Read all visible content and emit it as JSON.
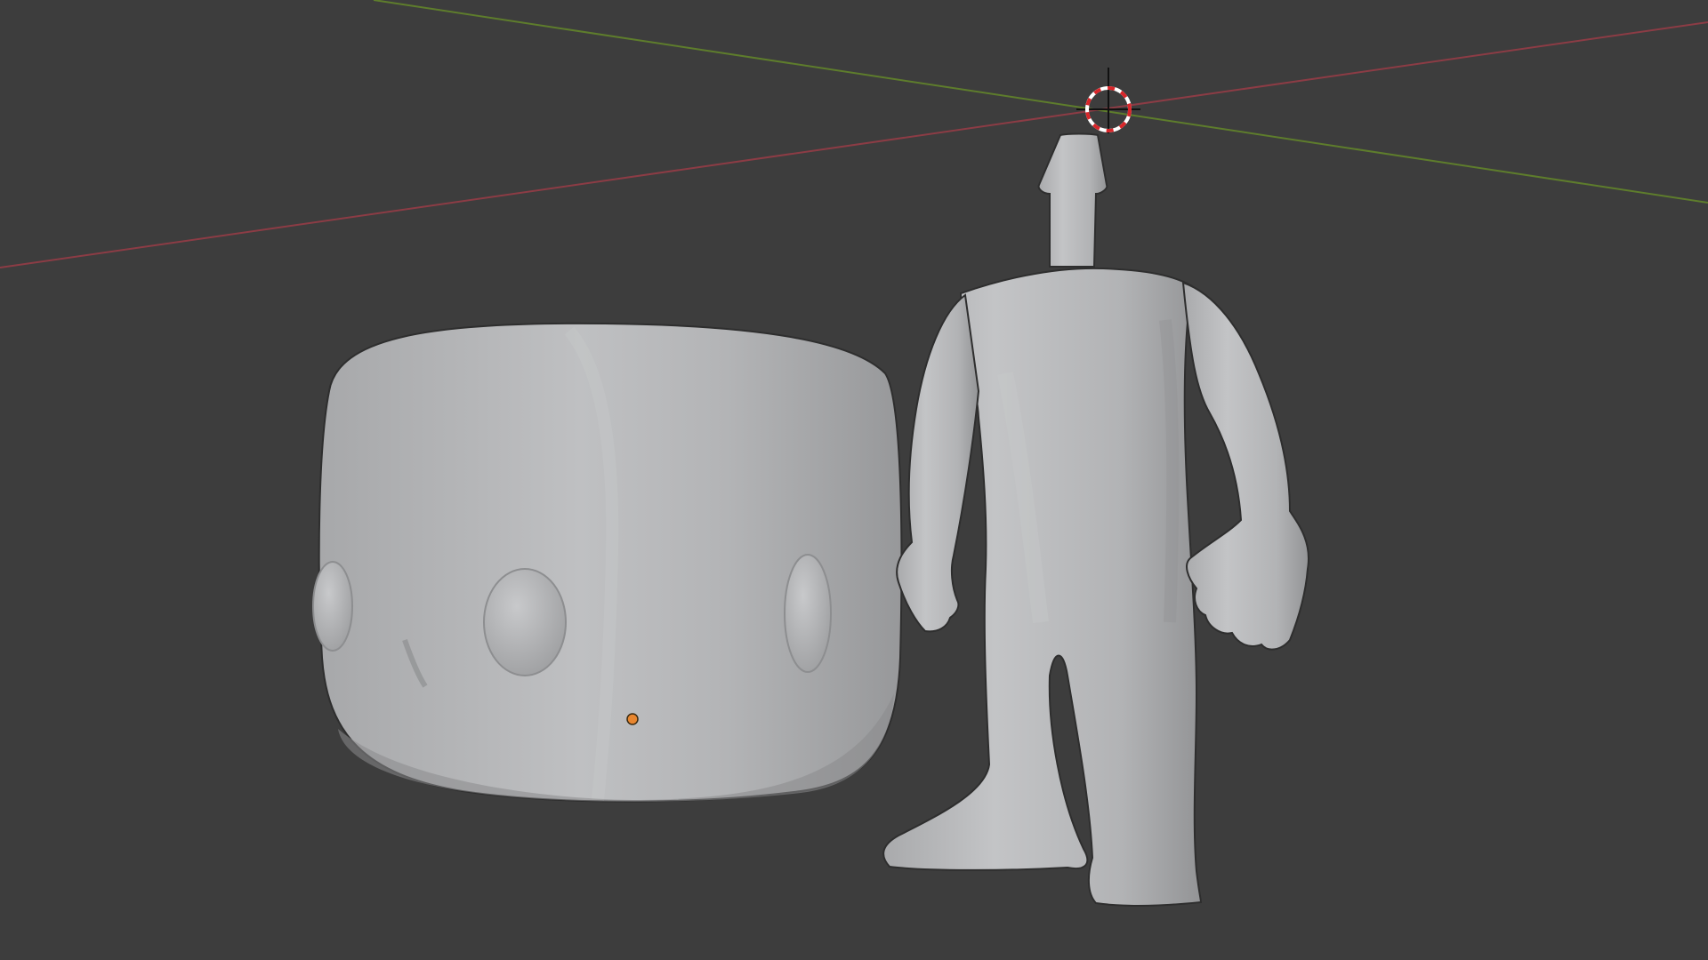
{
  "viewport": {
    "background_color": "#3d3d3d",
    "x_axis_color": "#8c3c45",
    "y_axis_color": "#5e7d2c",
    "mesh_color": "#b4b5b7",
    "origin_dot_color": "#e8862f"
  },
  "objects": [
    {
      "name": "Head",
      "type": "mesh",
      "selected": false
    },
    {
      "name": "Body",
      "type": "mesh",
      "selected": false
    }
  ],
  "icons": [
    "3d-cursor-icon",
    "origin-point-icon"
  ]
}
